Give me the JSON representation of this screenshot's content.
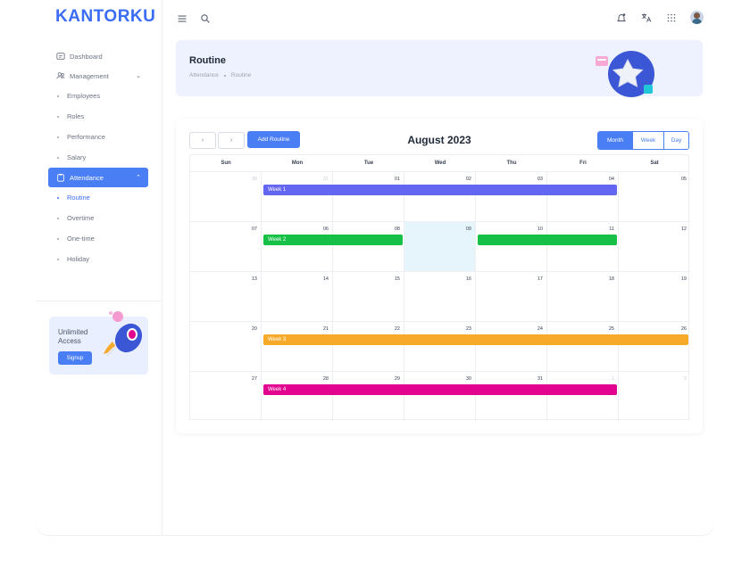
{
  "app": {
    "logo": "KANTORKU"
  },
  "colors": {
    "primary": "#4a7ef5",
    "week1": "#6366f1",
    "week2": "#16c047",
    "week3": "#f7aa2a",
    "week4": "#e2048f",
    "today": "#e6f4fc"
  },
  "sidebar": {
    "items": [
      {
        "label": "Dashboard",
        "icon": "dashboard-icon"
      },
      {
        "label": "Management",
        "icon": "users-icon"
      },
      {
        "label": "Employees"
      },
      {
        "label": "Roles"
      },
      {
        "label": "Performance"
      },
      {
        "label": "Salary"
      },
      {
        "label": "Attendance",
        "icon": "clipboard-icon"
      },
      {
        "label": "Routine"
      },
      {
        "label": "Overtime"
      },
      {
        "label": "One-time"
      },
      {
        "label": "Holiday"
      }
    ],
    "promo": {
      "title": "Unlimited Access",
      "button": "Signup"
    }
  },
  "header": {
    "title": "Routine",
    "breadcrumb": [
      "Attendance",
      "Routine"
    ]
  },
  "calendar": {
    "add_label": "Add Routine",
    "month_title": "August 2023",
    "views": [
      "Month",
      "Week",
      "Day"
    ],
    "active_view": "Month",
    "prev_icon": "‹",
    "next_icon": "›",
    "weekdays": [
      "Sun",
      "Mon",
      "Tue",
      "Wed",
      "Thu",
      "Fri",
      "Sat"
    ],
    "weeks": [
      [
        "30",
        "31",
        "01",
        "02",
        "03",
        "04",
        "05"
      ],
      [
        "07",
        "06",
        "08",
        "09",
        "10",
        "11",
        "12"
      ],
      [
        "13",
        "14",
        "15",
        "16",
        "17",
        "18",
        "19"
      ],
      [
        "20",
        "21",
        "22",
        "23",
        "24",
        "25",
        "26"
      ],
      [
        "27",
        "28",
        "29",
        "30",
        "31",
        "1",
        "2"
      ]
    ],
    "events": [
      {
        "label": "Week 1",
        "week": 0,
        "start": 1,
        "end": 5,
        "color": "#6366f1"
      },
      {
        "label": "Week 2",
        "week": 1,
        "start": 1,
        "end": 2,
        "color": "#16c047"
      },
      {
        "label": "",
        "week": 1,
        "start": 4,
        "end": 5,
        "color": "#16c047"
      },
      {
        "label": "Week 3",
        "week": 3,
        "start": 1,
        "end": 6,
        "color": "#f7aa2a"
      },
      {
        "label": "Week 4",
        "week": 4,
        "start": 1,
        "end": 5,
        "color": "#e2048f"
      }
    ]
  }
}
